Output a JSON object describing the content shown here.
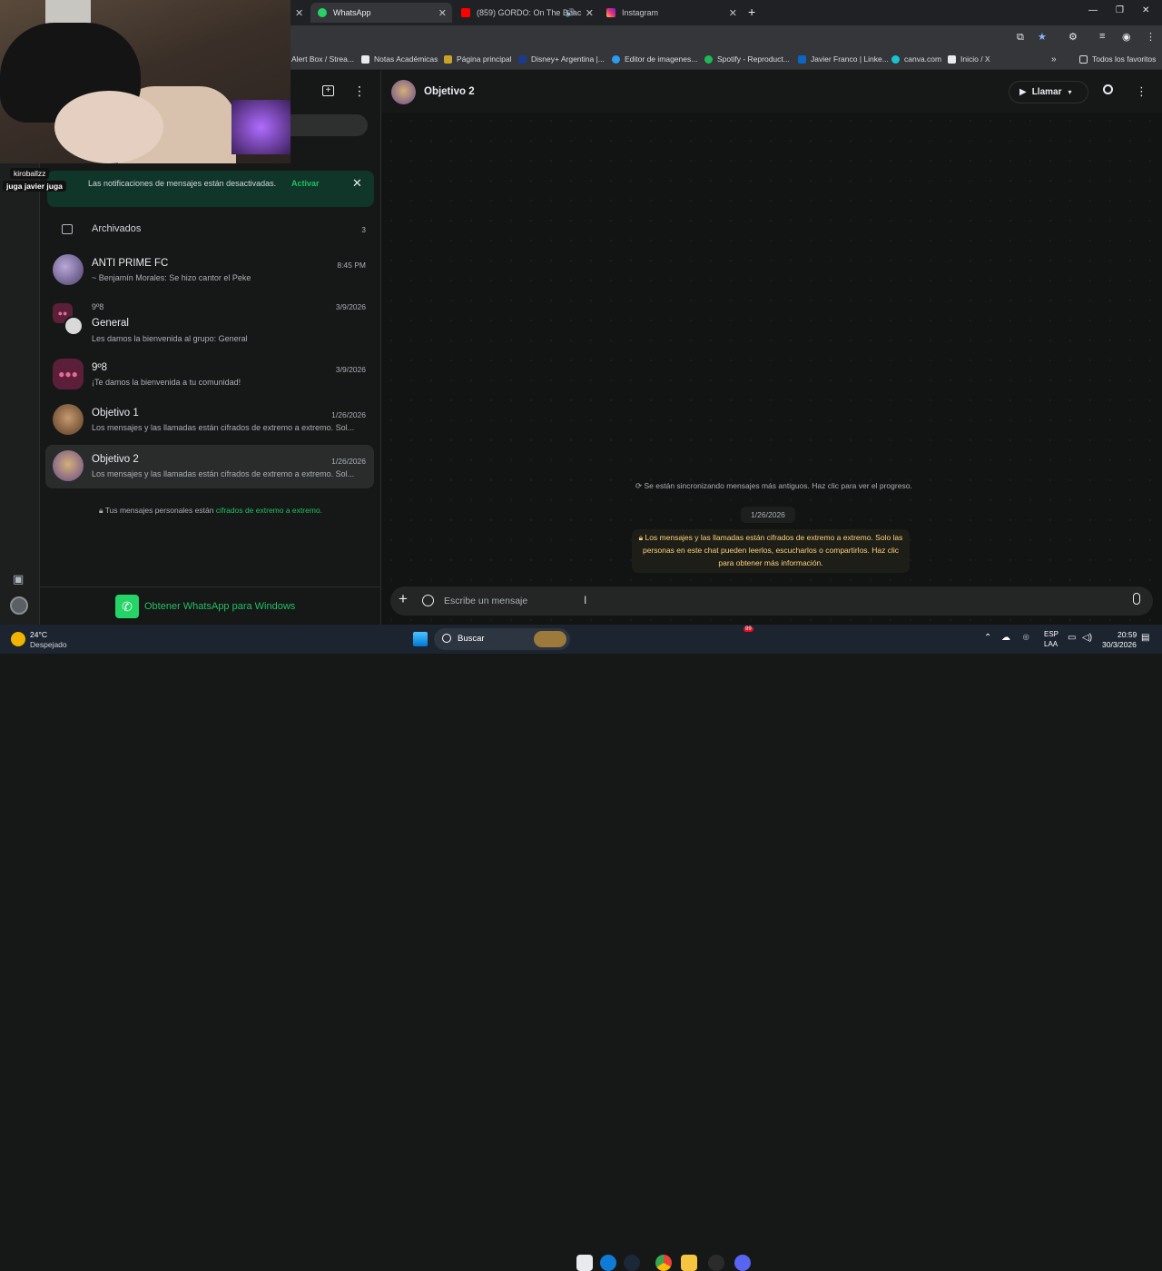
{
  "browser": {
    "tabs": [
      {
        "label": "WhatsApp",
        "active": true
      },
      {
        "label": "(859) GORDO: On The Beac"
      },
      {
        "label": "Instagram"
      }
    ],
    "bookmarks": [
      "Alert Box / Strea...",
      "Notas Académicas",
      "Página principal",
      "Disney+ Argentina |...",
      "Editor de imagenes...",
      "Spotify - Reproduct...",
      "Javier Franco | Linke...",
      "canva.com",
      "Inicio / X"
    ],
    "favorites_label": "Todos los favoritos"
  },
  "webcam": {
    "name": "kiroballzz",
    "caption": "juga javier juga"
  },
  "sidebar": {
    "notice": {
      "text": "Las notificaciones de mensajes están desactivadas.",
      "action": "Activar"
    },
    "archived": {
      "label": "Archivados",
      "count": "3"
    },
    "chats": [
      {
        "name": "ANTI PRIME FC",
        "message": "~ Benjamín Morales: Se hizo cantor el Peke",
        "date": "8:45 PM"
      },
      {
        "group": "9º8",
        "name": "General",
        "message": "Les damos la bienvenida al grupo: General",
        "date": "3/9/2026"
      },
      {
        "name": "9º8",
        "message": "¡Te damos la bienvenida a tu comunidad!",
        "date": "3/9/2026"
      },
      {
        "name": "Objetivo 1",
        "message": "Los mensajes y las llamadas están cifrados de extremo a extremo. Sol...",
        "date": "1/26/2026"
      },
      {
        "name": "Objetivo 2",
        "message": "Los mensajes y las llamadas están cifrados de extremo a extremo. Sol...",
        "date": "1/26/2026"
      }
    ],
    "encryption_note": {
      "prefix": "Tus mensajes personales están",
      "link": "cifrados de extremo a extremo."
    },
    "get_app": "Obtener WhatsApp para Windows"
  },
  "chat": {
    "title": "Objetivo 2",
    "call_label": "Llamar",
    "sync_notice": "Se están sincronizando mensajes más antiguos. Haz clic para ver el progreso.",
    "date_chip": "1/26/2026",
    "encryption_banner": "Los mensajes y las llamadas están cifrados de extremo a extremo. Solo las personas en este chat pueden leerlos, escucharlos o compartirlos. Haz clic para obtener más información.",
    "composer_placeholder": "Escribe un mensaje"
  },
  "taskbar": {
    "weather_temp": "24°C",
    "weather_desc": "Despejado",
    "search_label": "Buscar",
    "lang_top": "ESP",
    "lang_bottom": "LAA",
    "time": "20:59",
    "date": "30/3/2026",
    "badge": "99"
  },
  "colors": {
    "accent": "#21c063",
    "banner_text": "#ffd279",
    "sidebar_bg": "#161717"
  }
}
